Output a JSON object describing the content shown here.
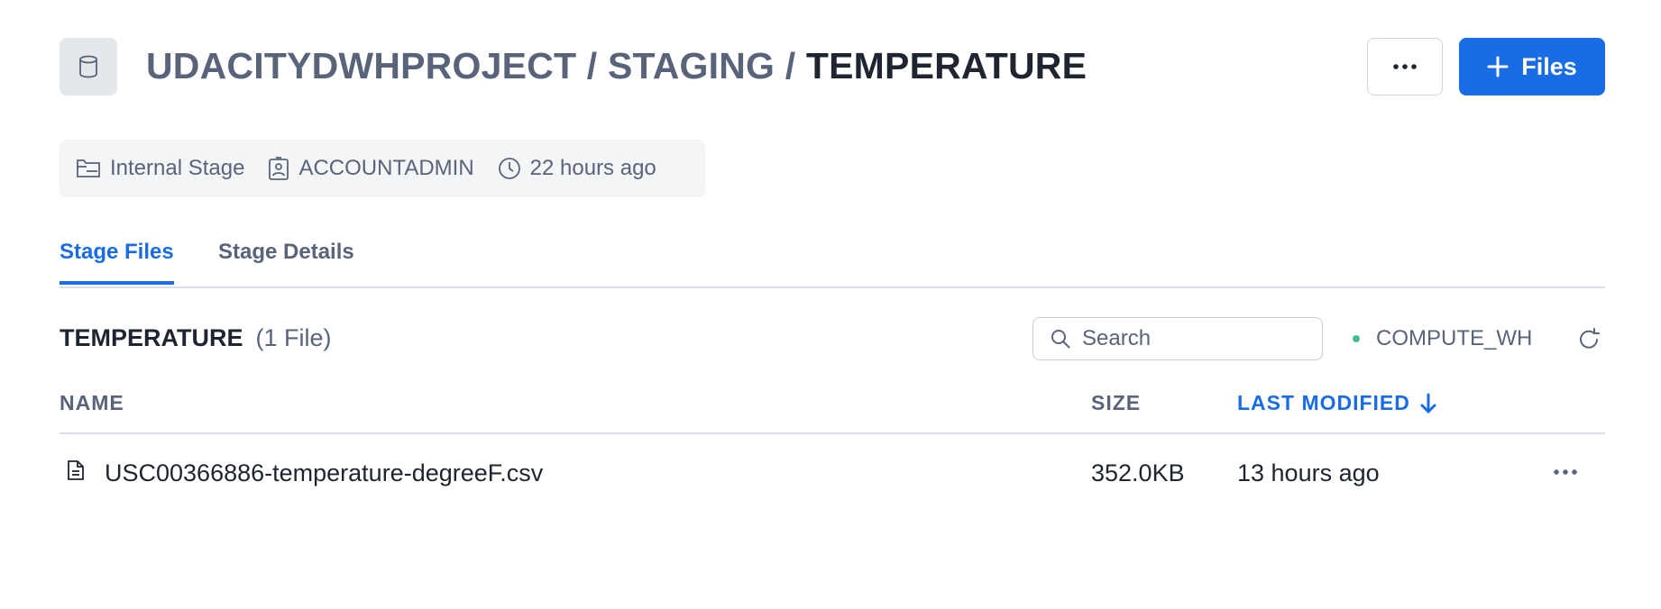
{
  "header": {
    "icon": "database-icon",
    "breadcrumb": [
      {
        "label": "UDACITYDWHPROJECT",
        "separator": " / "
      },
      {
        "label": "STAGING",
        "separator": " / "
      },
      {
        "label": "TEMPERATURE"
      }
    ],
    "more_icon": "ellipsis-icon",
    "files_button": {
      "icon": "plus-icon",
      "label": "Files"
    }
  },
  "meta": {
    "stage_type": {
      "icon": "folder-stage-icon",
      "label": "Internal Stage"
    },
    "owner": {
      "icon": "user-badge-icon",
      "label": "ACCOUNTADMIN"
    },
    "created": {
      "icon": "clock-icon",
      "label": "22 hours ago"
    }
  },
  "tabs": [
    {
      "label": "Stage Files",
      "active": true
    },
    {
      "label": "Stage Details",
      "active": false
    }
  ],
  "files_section": {
    "title": "TEMPERATURE",
    "count": "(1 File)",
    "search": {
      "placeholder": "Search",
      "value": "",
      "icon": "search-icon"
    },
    "warehouse": {
      "label": "COMPUTE_WH",
      "status_color": "#3fc28f"
    },
    "refresh_icon": "refresh-icon"
  },
  "table": {
    "columns": [
      {
        "label": "NAME"
      },
      {
        "label": "SIZE"
      },
      {
        "label": "LAST MODIFIED",
        "sorted": "descending",
        "sort_icon": "arrow-down-icon"
      }
    ],
    "rows": [
      {
        "icon": "file-icon",
        "name": "USC00366886-temperature-degreeF.csv",
        "size": "352.0KB",
        "modified": "13 hours ago",
        "menu_icon": "ellipsis-icon"
      }
    ]
  },
  "colors": {
    "accent": "#1a6ce6",
    "text_primary": "#1e2530",
    "text_muted": "#59647a",
    "status_green": "#3fc28f"
  }
}
